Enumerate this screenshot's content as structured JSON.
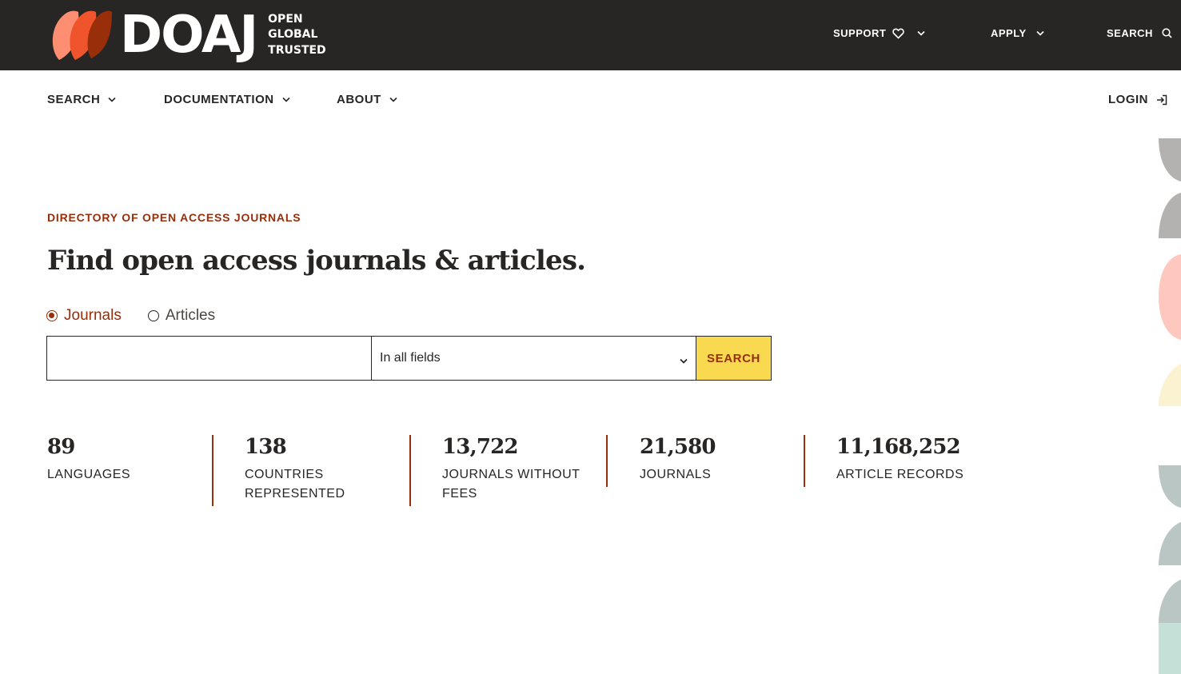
{
  "brand": {
    "wordmark": "DOAJ",
    "tagline": [
      "OPEN",
      "GLOBAL",
      "TRUSTED"
    ]
  },
  "topnav": {
    "support": "SUPPORT",
    "apply": "APPLY",
    "search": "SEARCH"
  },
  "subnav": {
    "search": "SEARCH",
    "documentation": "DOCUMENTATION",
    "about": "ABOUT",
    "login": "LOGIN"
  },
  "hero": {
    "eyebrow": "DIRECTORY OF OPEN ACCESS JOURNALS",
    "headline": "Find open access journals & articles."
  },
  "search": {
    "type_options": [
      {
        "label": "Journals",
        "checked": true
      },
      {
        "label": "Articles",
        "checked": false
      }
    ],
    "query_value": "",
    "query_placeholder": "",
    "field_selected": "In all fields",
    "button_label": "SEARCH"
  },
  "stats": [
    {
      "value": "89",
      "label_lines": [
        "LANGUAGES"
      ]
    },
    {
      "value": "138",
      "label_lines": [
        "COUNTRIES",
        "REPRESENTED"
      ]
    },
    {
      "value": "13,722",
      "label_lines": [
        "JOURNALS WITHOUT",
        "FEES"
      ]
    },
    {
      "value": "21,580",
      "label_lines": [
        "JOURNALS"
      ]
    },
    {
      "value": "11,168,252",
      "label_lines": [
        "ARTICLE RECORDS"
      ]
    }
  ],
  "colors": {
    "dark": "#282624",
    "accent": "#982E0A",
    "button": "#F9D950",
    "logo_light": "#FD8E72",
    "logo_mid": "#F0542D",
    "logo_dark": "#982E0A"
  },
  "icons": {
    "support": "heart-icon",
    "search": "search-icon",
    "login": "login-icon",
    "dropdown": "chevron-down-icon"
  }
}
